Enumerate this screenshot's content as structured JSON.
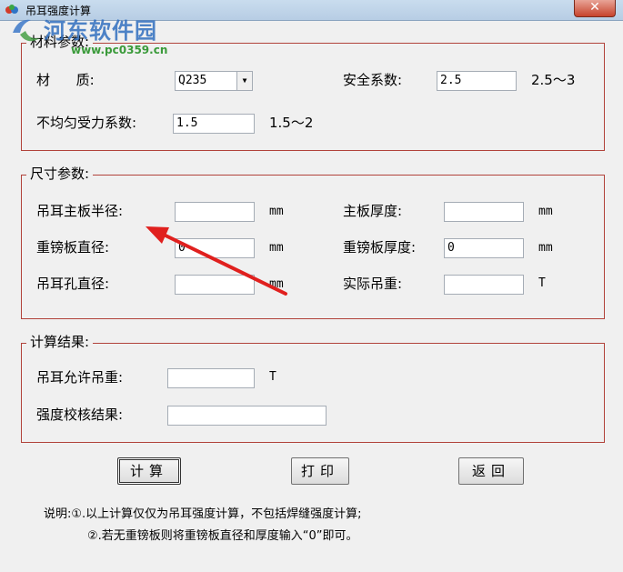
{
  "window": {
    "title": "吊耳强度计算",
    "close_label": "✕"
  },
  "watermark": {
    "site_name": "河东软件园",
    "url": "www.pc0359.cn"
  },
  "material_group": {
    "title": "材料参数:",
    "material_label": "材      质:",
    "material_value": "Q235",
    "safety_label": "安全系数:",
    "safety_value": "2.5",
    "safety_range": "2.5～3",
    "uneven_label": "不均匀受力系数:",
    "uneven_value": "1.5",
    "uneven_range": "1.5～2"
  },
  "size_group": {
    "title": "尺寸参数:",
    "main_radius_label": "吊耳主板半径:",
    "main_radius_value": "",
    "main_radius_unit": "mm",
    "main_thickness_label": "主板厚度:",
    "main_thickness_value": "",
    "main_thickness_unit": "mm",
    "doubler_diameter_label": "重镑板直径:",
    "doubler_diameter_value": "0",
    "doubler_diameter_unit": "mm",
    "doubler_thickness_label": "重镑板厚度:",
    "doubler_thickness_value": "0",
    "doubler_thickness_unit": "mm",
    "hole_diameter_label": "吊耳孔直径:",
    "hole_diameter_value": "",
    "hole_diameter_unit": "mm",
    "actual_load_label": "实际吊重:",
    "actual_load_value": "",
    "actual_load_unit": "T"
  },
  "result_group": {
    "title": "计算结果:",
    "allowed_load_label": "吊耳允许吊重:",
    "allowed_load_value": "",
    "allowed_load_unit": "T",
    "check_result_label": "强度校核结果:",
    "check_result_value": ""
  },
  "buttons": {
    "calculate": "计算",
    "print": "打印",
    "back": "返回"
  },
  "notes": {
    "line1": "说明:①.以上计算仅仅为吊耳强度计算，不包括焊缝强度计算;",
    "line2": "②.若无重镑板则将重镑板直径和厚度输入“0”即可。"
  },
  "colors": {
    "group_border": "#b1423a",
    "arrow": "#e0201e",
    "background": "#f0f0f0"
  },
  "icons": {
    "app": "app-icon",
    "close": "close-icon",
    "dropdown": "dropdown-arrow-icon",
    "annotation": "red-arrow-annotation"
  }
}
